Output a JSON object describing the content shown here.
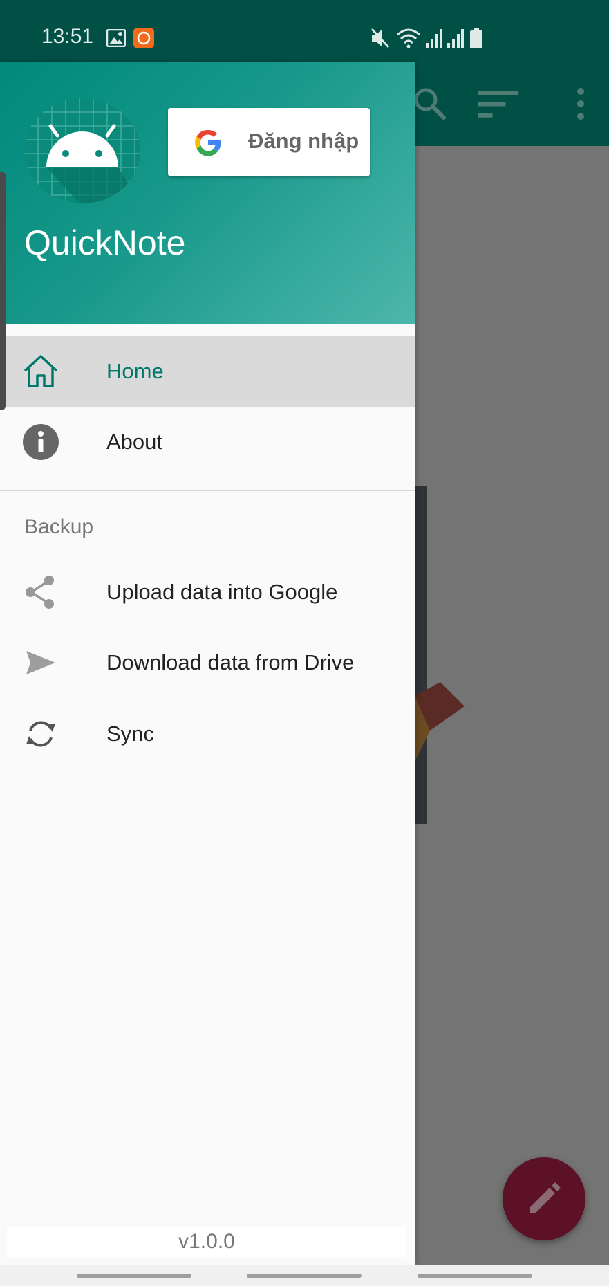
{
  "status_bar": {
    "time": "13:51",
    "icons": [
      "gallery-icon",
      "notification-app-icon",
      "mute-icon",
      "wifi-icon",
      "signal-icon",
      "signal-icon",
      "battery-icon"
    ]
  },
  "background_app": {
    "toolbar_icons": [
      "search-icon",
      "sort-icon",
      "more-vert-icon"
    ],
    "fab_icon": "edit-icon"
  },
  "drawer": {
    "app_title": "QuickNote",
    "signin_label": "Đăng nhập",
    "menu": [
      {
        "label": "Home",
        "icon": "home-icon",
        "active": true
      },
      {
        "label": "About",
        "icon": "info-icon",
        "active": false
      }
    ],
    "section_title": "Backup",
    "backup_items": [
      {
        "label": "Upload data into Google",
        "icon": "share-icon"
      },
      {
        "label": "Download data from Drive",
        "icon": "send-icon"
      },
      {
        "label": "Sync",
        "icon": "sync-icon"
      }
    ],
    "version": "v1.0.0"
  },
  "colors": {
    "primary_dark": "#005046",
    "header_gradient_start": "#00897b",
    "header_gradient_end": "#4db6ac",
    "active_text": "#00796b",
    "fab": "#5c1126"
  }
}
